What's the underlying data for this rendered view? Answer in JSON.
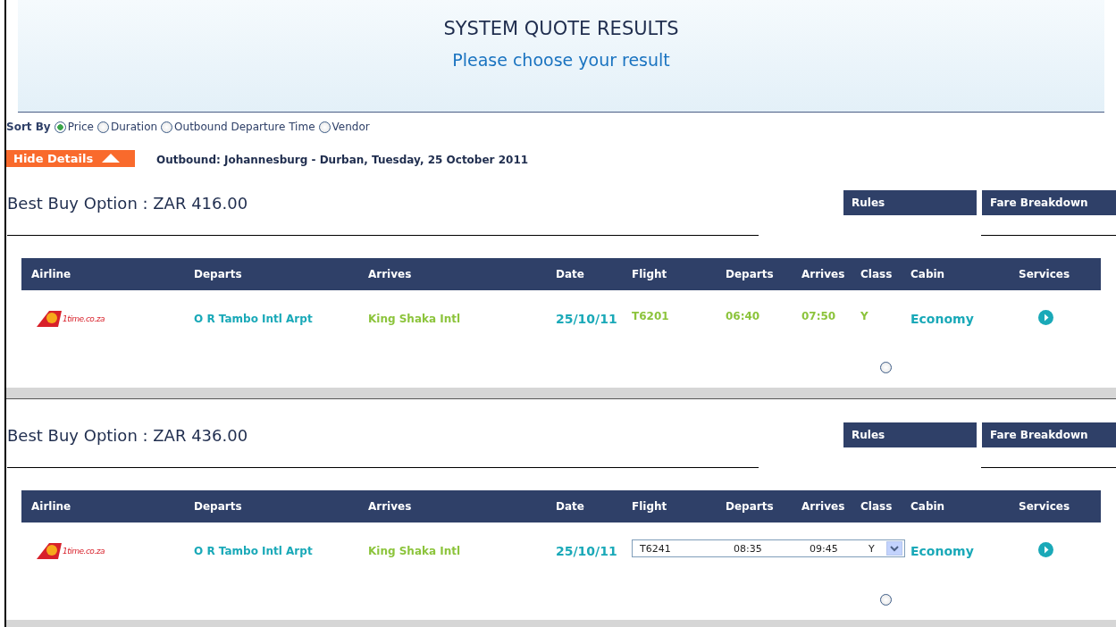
{
  "header": {
    "title": "SYSTEM QUOTE RESULTS",
    "subtitle": "Please choose your result"
  },
  "sort": {
    "label": "Sort By",
    "options": [
      {
        "label": "Price",
        "selected": true
      },
      {
        "label": "Duration",
        "selected": false
      },
      {
        "label": "Outbound Departure Time",
        "selected": false
      },
      {
        "label": "Vendor",
        "selected": false
      }
    ]
  },
  "details_button": "Hide Details",
  "route": "Outbound: Johannesburg - Durban, Tuesday, 25 October 2011",
  "options": [
    {
      "title": "Best Buy Option : ZAR 416.00",
      "buttons": [
        "Rules",
        "Fare Breakdown"
      ],
      "columns": [
        "Airline",
        "Departs",
        "Arrives",
        "Date",
        "Flight",
        "Departs",
        "Arrives",
        "Class",
        "Cabin",
        "Services"
      ],
      "row": {
        "logo_text": "1time.co.za",
        "from": "O R Tambo Intl Arpt",
        "to": "King Shaka Intl",
        "date": "25/10/11",
        "kind": "text",
        "flight": "T6201",
        "departs": "06:40",
        "arrives": "07:50",
        "class": "Y",
        "cabin": "Economy"
      },
      "selected": false
    },
    {
      "title": "Best Buy Option : ZAR 436.00",
      "buttons": [
        "Rules",
        "Fare Breakdown"
      ],
      "columns": [
        "Airline",
        "Departs",
        "Arrives",
        "Date",
        "Flight",
        "Departs",
        "Arrives",
        "Class",
        "Cabin",
        "Services"
      ],
      "row": {
        "logo_text": "1time.co.za",
        "from": "O R Tambo Intl Arpt",
        "to": "King Shaka Intl",
        "date": "25/10/11",
        "kind": "select",
        "flight": "T6241",
        "departs": "08:35",
        "arrives": "09:45",
        "class": "Y",
        "cabin": "Economy"
      },
      "selected": false
    }
  ]
}
